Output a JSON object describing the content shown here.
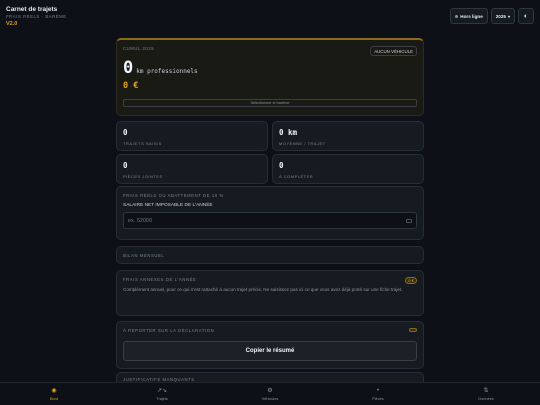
{
  "header": {
    "title": "Carnet de trajets",
    "subtitle": "FRAIS RÉELS · BARÈME",
    "version": "V2.0",
    "status_label": "Hors ligne",
    "year": "2025",
    "theme_icon": "◐"
  },
  "hero": {
    "eyebrow": "CUMUL 2025",
    "vehicle_tag": "AUCUN VÉHICULE",
    "km_value": "0",
    "km_unit": "km professionnels",
    "euro_value": "0 €",
    "bareme_button": "Sélectionner le barème"
  },
  "stats": [
    {
      "value": "0",
      "label": "TRAJETS SAISIS"
    },
    {
      "value": "0 km",
      "label": "MOYENNE / TRAJET"
    },
    {
      "value": "0",
      "label": "PIÈCES JOINTES"
    },
    {
      "value": "0",
      "label": "À COMPLÉTER"
    }
  ],
  "salary": {
    "eyebrow": "FRAIS RÉELS OU ABATTEMENT DE 10 %",
    "label": "SALAIRE NET IMPOSABLE DE L'ANNÉE",
    "placeholder": "ex. 52000"
  },
  "bilan": {
    "eyebrow": "BILAN MENSUEL"
  },
  "frais": {
    "eyebrow": "FRAIS ANNEXES DE L'ANNÉE",
    "badge": "0 €",
    "text": "Complément annuel, pour ce qui n'est rattaché à aucun trajet précis. Ne saisissez pas ici ce que vous avez déjà porté sur une fiche trajet."
  },
  "report": {
    "eyebrow": "À REPORTER SUR LA DÉCLARATION",
    "copy_button": "Copier le résumé"
  },
  "justif": {
    "eyebrow": "JUSTIFICATIFS MANQUANTS"
  },
  "nav": [
    {
      "label": "Bord",
      "icon": "◉",
      "active": true
    },
    {
      "label": "Trajets",
      "icon": "↗↘",
      "active": false
    },
    {
      "label": "Véhicules",
      "icon": "⚙",
      "active": false
    },
    {
      "label": "Pièces",
      "icon": "•",
      "active": false
    },
    {
      "label": "Données",
      "icon": "⇅",
      "active": false
    }
  ],
  "colors": {
    "accent": "#e3a21a",
    "background": "#0d1117",
    "card": "#161b22"
  }
}
